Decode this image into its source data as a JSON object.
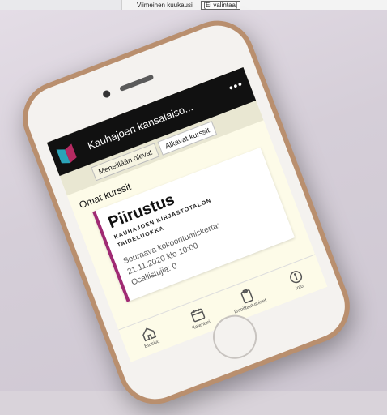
{
  "browser_strip": {
    "label": "Viimeinen kuukausi",
    "select_value": "[Ei valintaa]"
  },
  "app": {
    "title": "Kauhajoen kansalaiso...",
    "more_icon": "more-icon"
  },
  "tabs": [
    {
      "label": "Meneillään olevat",
      "active": false
    },
    {
      "label": "Alkavat kurssit",
      "active": true
    }
  ],
  "main": {
    "section_title": "Omat kurssit",
    "card": {
      "name": "Piirustus",
      "location_line1": "KAUHAJOEN KIRJASTOTALON",
      "location_line2": "TAIDELUOKKA",
      "next_label": "Seuraava kokoontumiskerta:",
      "next_datetime": "21.11.2020 klo 10:00",
      "participants": "Osallistujia: 0"
    }
  },
  "bottom_nav": [
    {
      "label": "Etusivu",
      "icon": "home-icon"
    },
    {
      "label": "Kalenteri",
      "icon": "calendar-icon"
    },
    {
      "label": "Ilmoittautumiset",
      "icon": "clipboard-icon"
    },
    {
      "label": "Info",
      "icon": "info-icon"
    }
  ],
  "colors": {
    "accent": "#a02a73",
    "header": "#111111",
    "screen_bg": "#fdfbe8"
  }
}
